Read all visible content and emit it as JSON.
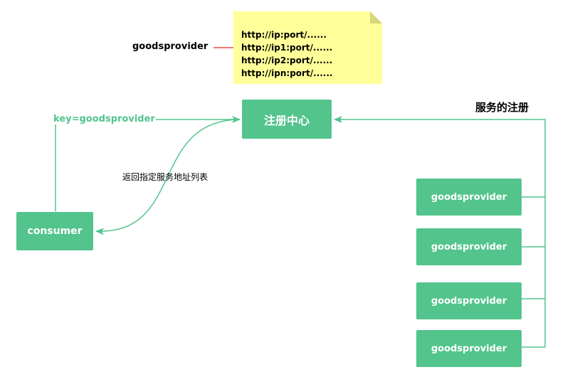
{
  "note": {
    "key_label": "goodsprovider",
    "urls": [
      "http://ip:port/......",
      "http://ip1:port/......",
      "http://ip2:port/......",
      "http://ipn:port/......"
    ]
  },
  "registry": {
    "label": "注册中心"
  },
  "consumer": {
    "label": "consumer",
    "key_text": "key=goodsprovider"
  },
  "return_label": "返回指定服务地址列表",
  "registration_label": "服务的注册",
  "providers": [
    "goodsprovider",
    "goodsprovider",
    "goodsprovider",
    "goodsprovider"
  ],
  "colors": {
    "box": "#52c48c",
    "line": "#52c48c",
    "note_bg": "#ffff99",
    "note_fold": "#d6d67a",
    "connector": "#e84c3d"
  }
}
